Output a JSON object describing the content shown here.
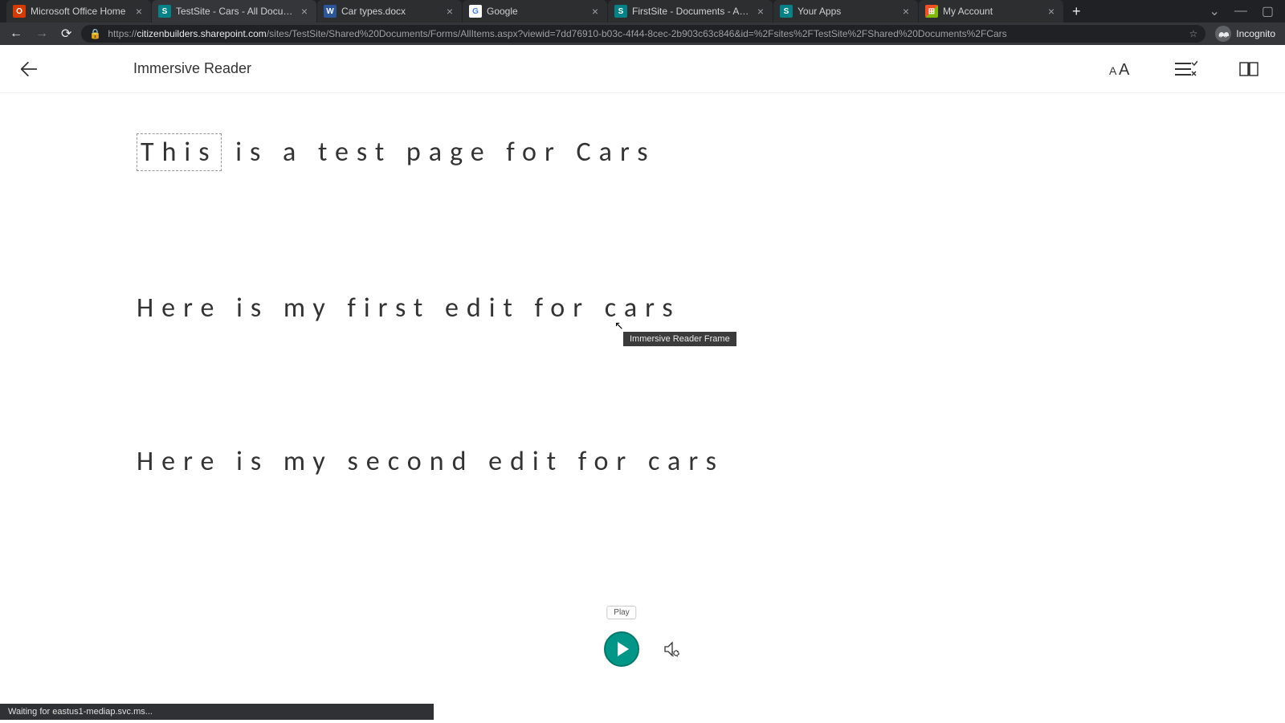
{
  "browser": {
    "tabs": [
      {
        "title": "Microsoft Office Home",
        "favicon_bg": "#d83b01",
        "favicon_text": "O"
      },
      {
        "title": "TestSite - Cars - All Documents",
        "favicon_bg": "#038387",
        "favicon_text": "S",
        "active": true
      },
      {
        "title": "Car types.docx",
        "favicon_bg": "#2b579a",
        "favicon_text": "W"
      },
      {
        "title": "Google",
        "favicon_bg": "#ffffff",
        "favicon_text": "G"
      },
      {
        "title": "FirstSite - Documents - All Docu",
        "favicon_bg": "#038387",
        "favicon_text": "S"
      },
      {
        "title": "Your Apps",
        "favicon_bg": "#038387",
        "favicon_text": "S"
      },
      {
        "title": "My Account",
        "favicon_bg": "#00a4ef",
        "favicon_text": "⊞"
      }
    ],
    "url_domain": "citizenbuilders.sharepoint.com",
    "url_path": "/sites/TestSite/Shared%20Documents/Forms/AllItems.aspx?viewid=7dd76910-b03c-4f44-8cec-2b903c63c846&id=%2Fsites%2FTestSite%2FShared%20Documents%2FCars",
    "url_prefix": "https://",
    "incognito_label": "Incognito",
    "status_text": "Waiting for eastus1-mediap.svc.ms..."
  },
  "reader": {
    "title": "Immersive Reader",
    "tooltip": "Immersive Reader Frame",
    "play_label": "Play",
    "content": {
      "line1_first_word": "This",
      "line1_rest": " is a test page for Cars",
      "line2": "Here is my first edit for cars",
      "line3": "Here is my second edit for cars"
    }
  }
}
